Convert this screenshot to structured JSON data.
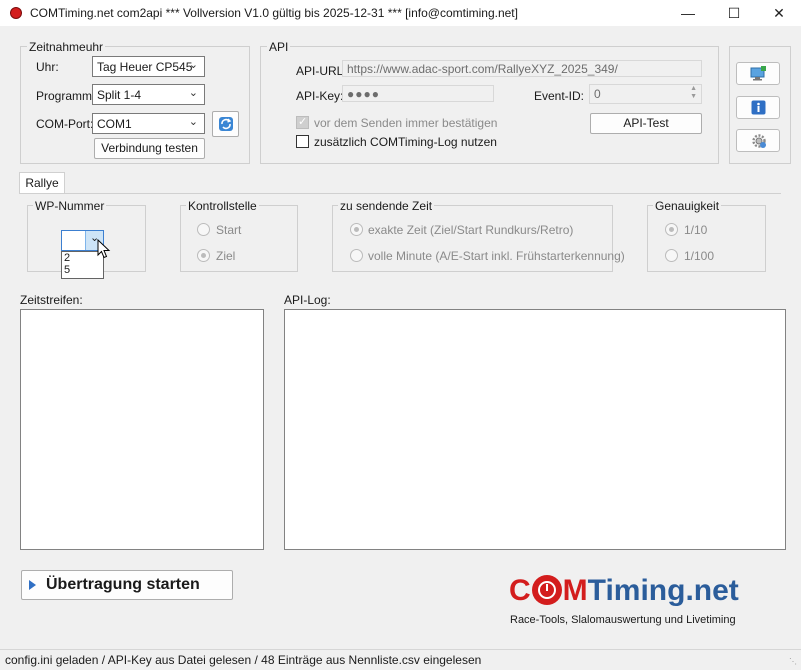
{
  "window": {
    "title": "COMTiming.net com2api *** Vollversion V1.0 gültig bis 2025-12-31 *** [info@comtiming.net]",
    "min_symbol": "—",
    "max_symbol": "☐",
    "close_symbol": "✕"
  },
  "zeitnahme": {
    "group_title": "Zeitnahmeuhr",
    "uhr_label": "Uhr:",
    "uhr_value": "Tag Heuer CP545",
    "programm_label": "Programm:",
    "programm_value": "Split 1-4",
    "comport_label": "COM-Port:",
    "comport_value": "COM1",
    "test_button": "Verbindung testen"
  },
  "api": {
    "group_title": "API",
    "url_label": "API-URL:",
    "url_value": "https://www.adac-sport.com/RallyeXYZ_2025_349/",
    "key_label": "API-Key:",
    "key_value": "●●●●",
    "event_label": "Event-ID:",
    "event_value": "0",
    "confirm_label": "vor dem Senden immer bestätigen",
    "log_label": "zusätzlich COMTiming-Log nutzen",
    "test_button": "API-Test"
  },
  "tabs": [
    "Rallye"
  ],
  "rallye": {
    "wp_title": "WP-Nummer",
    "wp_options": [
      "2",
      "5"
    ],
    "kontroll_title": "Kontrollstelle",
    "kontroll_options": [
      "Start",
      "Ziel"
    ],
    "zeit_title": "zu sendende Zeit",
    "zeit_options": [
      "exakte Zeit (Ziel/Start Rundkurs/Retro)",
      "volle Minute (A/E-Start inkl. Frühstarterkennung)"
    ],
    "genau_title": "Genauigkeit",
    "genau_options": [
      "1/10",
      "1/100"
    ]
  },
  "zeitstreifen_label": "Zeitstreifen:",
  "apilog_label": "API-Log:",
  "start_button": "Übertragung starten",
  "logo": {
    "prefix": "C",
    "middle": "M",
    "suffix": "Timing.net",
    "tagline": "Race-Tools, Slalomauswertung und Livetiming"
  },
  "status_text": "config.ini geladen / API-Key aus Datei gelesen / 48 Einträge aus Nennliste.csv eingelesen",
  "colors": {
    "logo_red": "#d31d1d",
    "logo_blue": "#2b5d9b",
    "button_arrow": "#2f6fc4"
  }
}
